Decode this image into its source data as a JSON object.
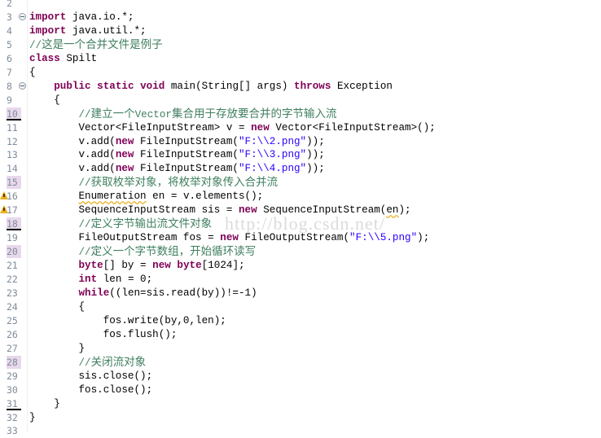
{
  "editor": {
    "language": "java",
    "colors": {
      "keyword": "#7f0055",
      "string": "#2a00ff",
      "comment": "#3f7f5f",
      "line_number": "#7f8b9a",
      "changed_line_bg": "#e8d8ec",
      "warning": "#e8b020"
    },
    "watermark": "http://blog.csdn.net/",
    "lines": [
      {
        "n": "2",
        "text": ""
      },
      {
        "n": "3",
        "text": "import java.io.*;",
        "fold": true
      },
      {
        "n": "4",
        "text": "import java.util.*;"
      },
      {
        "n": "5",
        "text": "//这是一个合并文件是例子"
      },
      {
        "n": "6",
        "text": "class Spilt"
      },
      {
        "n": "7",
        "text": "{"
      },
      {
        "n": "8",
        "text": "    public static void main(String[] args) throws Exception",
        "fold": true
      },
      {
        "n": "9",
        "text": "    {"
      },
      {
        "n": "10",
        "text": "        //建立一个Vector集合用于存放要合并的字节输入流",
        "changed": true,
        "underline": true
      },
      {
        "n": "11",
        "text": "        Vector<FileInputStream> v = new Vector<FileInputStream>();"
      },
      {
        "n": "12",
        "text": "        v.add(new FileInputStream(\"F:\\\\2.png\"));"
      },
      {
        "n": "13",
        "text": "        v.add(new FileInputStream(\"F:\\\\3.png\"));"
      },
      {
        "n": "14",
        "text": "        v.add(new FileInputStream(\"F:\\\\4.png\"));"
      },
      {
        "n": "15",
        "text": "        //获取枚举对象，将枚举对象传入合并流",
        "changed": true
      },
      {
        "n": "16",
        "text": "        Enumeration en = v.elements();",
        "warning": true
      },
      {
        "n": "17",
        "text": "        SequenceInputStream sis = new SequenceInputStream(en);",
        "warning": true
      },
      {
        "n": "18",
        "text": "        //定义字节输出流文件对象",
        "changed": true,
        "underline": true
      },
      {
        "n": "19",
        "text": "        FileOutputStream fos = new FileOutputStream(\"F:\\\\5.png\");"
      },
      {
        "n": "20",
        "text": "        //定义一个字节数组，开始循环读写",
        "changed": true
      },
      {
        "n": "21",
        "text": "        byte[] by = new byte[1024];"
      },
      {
        "n": "22",
        "text": "        int len = 0;"
      },
      {
        "n": "23",
        "text": "        while((len=sis.read(by))!=-1)"
      },
      {
        "n": "24",
        "text": "        {"
      },
      {
        "n": "25",
        "text": "            fos.write(by,0,len);"
      },
      {
        "n": "26",
        "text": "            fos.flush();"
      },
      {
        "n": "27",
        "text": "        }"
      },
      {
        "n": "28",
        "text": "        //关闭流对象",
        "changed": true
      },
      {
        "n": "29",
        "text": "        sis.close();"
      },
      {
        "n": "30",
        "text": "        fos.close();"
      },
      {
        "n": "31",
        "text": "    }",
        "underline": true
      },
      {
        "n": "32",
        "text": "}"
      },
      {
        "n": "33",
        "text": ""
      }
    ]
  }
}
